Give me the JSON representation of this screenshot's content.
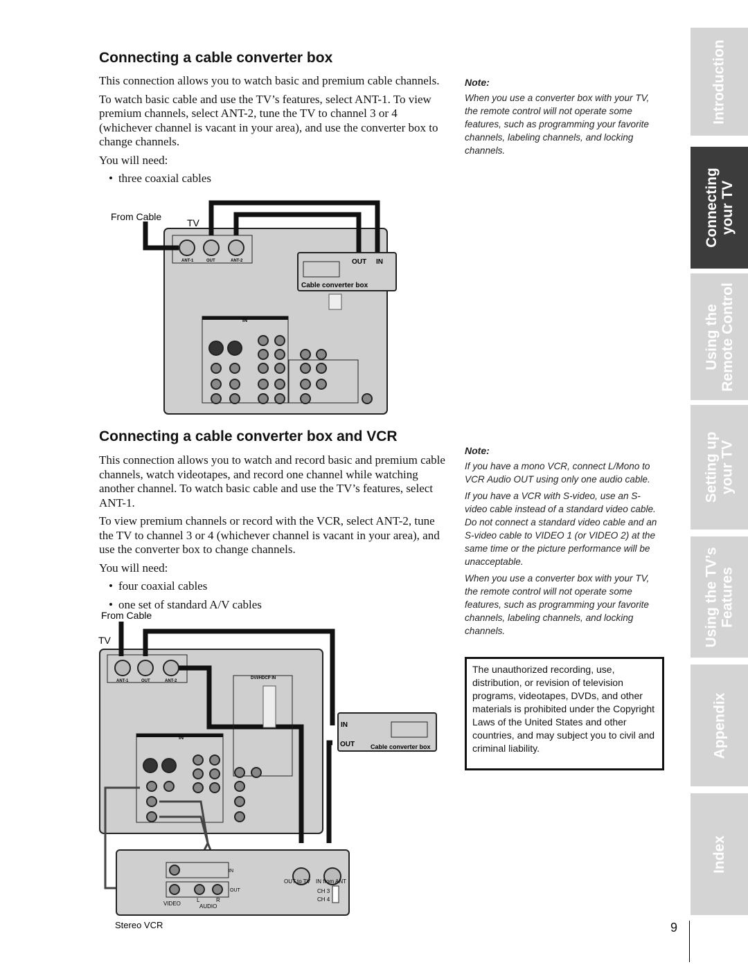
{
  "section1": {
    "title": "Connecting a cable converter box",
    "paragraphs": [
      "This connection allows you to watch basic and premium cable channels.",
      "To watch basic cable and use the TV’s features, select ANT-1. To view premium channels, select ANT-2, tune the TV to channel 3 or 4 (whichever channel is vacant in your area), and use the converter box to change channels.",
      "You will need:"
    ],
    "bullets": [
      "three coaxial cables"
    ],
    "note_title": "Note:",
    "note": "When you use a converter box with your TV, the remote control will not operate some features, such as programming your favorite channels, labeling channels, and locking channels.",
    "diagram": {
      "from_cable": "From Cable",
      "tv": "TV",
      "ant1": "ANT-1",
      "out": "OUT",
      "ant2": "ANT-2",
      "box_out": "OUT",
      "box_in": "IN",
      "box_label": "Cable converter box",
      "in": "IN"
    }
  },
  "section2": {
    "title": "Connecting a cable converter box and VCR",
    "paragraphs": [
      "This connection allows you to watch and record basic and premium cable channels, watch videotapes, and record one channel while watching another channel. To watch basic cable and use the TV’s features, select ANT-1.",
      "To view premium channels or record with the VCR, select ANT-2, tune the TV to channel 3 or 4 (whichever channel is vacant in your area), and use the converter box to change channels.",
      "You will need:"
    ],
    "bullets": [
      "four coaxial cables",
      "one set of standard A/V cables"
    ],
    "note_title": "Note:",
    "notes": [
      "If you have a mono VCR, connect L/Mono to VCR Audio OUT using only one audio cable.",
      "If you have a VCR with S-video, use an S-video cable instead of a standard video cable. Do not connect a standard video cable and an S-video cable to VIDEO 1 (or VIDEO 2) at the same time or the picture performance will be unacceptable.",
      "When you use a converter box with your TV, the remote control will not operate some features, such as programming your favorite channels, labeling channels, and locking channels."
    ],
    "notice": "The unauthorized recording, use, distribution, or revision of television programs, videotapes, DVDs, and other materials is prohibited under the Copyright Laws of the United States and other countries, and may subject you to civil and criminal liability.",
    "diagram": {
      "from_cable": "From Cable",
      "tv": "TV",
      "ant1": "ANT-1",
      "out": "OUT",
      "ant2": "ANT-2",
      "dvi": "DVI/HDCP IN",
      "in": "IN",
      "box_in": "IN",
      "box_out": "OUT",
      "box_label": "Cable converter box",
      "vcr_in": "IN",
      "vcr_out": "OUT",
      "out_to_tv": "OUT to TV",
      "in_from_ant": "IN from ANT",
      "ch3": "CH 3",
      "ch4": "CH 4",
      "video": "VIDEO",
      "l": "L",
      "r": "R",
      "audio": "AUDIO",
      "vcr_label": "Stereo VCR"
    }
  },
  "tabs": [
    {
      "label": "Introduction",
      "active": false
    },
    {
      "label": "Connecting\nyour TV",
      "active": true
    },
    {
      "label": "Using the\nRemote Control",
      "active": false
    },
    {
      "label": "Setting up\nyour TV",
      "active": false
    },
    {
      "label": "Using the TV’s\nFeatures",
      "active": false
    },
    {
      "label": "Appendix",
      "active": false
    },
    {
      "label": "Index",
      "active": false
    }
  ],
  "page_number": "9"
}
